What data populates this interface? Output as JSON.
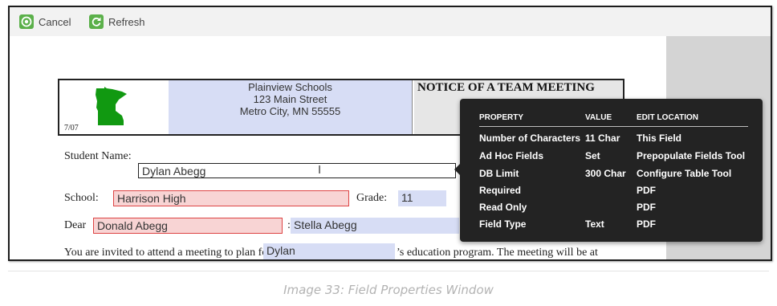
{
  "toolbar": {
    "cancel_label": "Cancel",
    "refresh_label": "Refresh"
  },
  "letterhead": {
    "form_code": "7/07",
    "school_name": "Plainview Schools",
    "address_line1": "123 Main Street",
    "address_line2": "Metro City, MN  55555",
    "title": "NOTICE OF A TEAM MEETING"
  },
  "form": {
    "student_name_label": "Student Name:",
    "student_name_value": "Dylan Abegg",
    "school_label": "School:",
    "school_value": "Harrison High",
    "grade_label": "Grade:",
    "grade_value": "11",
    "dear_label": "Dear",
    "dear_value1": "Donald Abegg",
    "dear_sep": ":",
    "dear_value2": "Stella Abegg",
    "invite_text": "You are invited to attend a meeting to plan for",
    "invite_value": "Dylan",
    "invite_text2": "’s education program. The meeting will be at"
  },
  "popup": {
    "headers": [
      "PROPERTY",
      "VALUE",
      "EDIT LOCATION"
    ],
    "rows": [
      {
        "property": "Number of Characters",
        "value": "11 Char",
        "location": "This Field"
      },
      {
        "property": "Ad Hoc Fields",
        "value": "Set",
        "location": "Prepopulate Fields Tool"
      },
      {
        "property": "DB Limit",
        "value": "300 Char",
        "location": "Configure Table Tool"
      },
      {
        "property": "Required",
        "value": "",
        "location": "PDF"
      },
      {
        "property": "Read Only",
        "value": "",
        "location": "PDF"
      },
      {
        "property": "Field Type",
        "value": "Text",
        "location": "PDF"
      }
    ]
  },
  "caption": "Image 33: Field Properties Window",
  "colors": {
    "toolbar_icon": "#5bb04a",
    "field_blue": "#d7ddf5",
    "field_red_border": "#dd4444",
    "popup_bg": "#232323",
    "map_green": "#119911"
  },
  "icons": [
    "cancel-circle-icon",
    "refresh-icon",
    "minnesota-map-icon",
    "text-cursor-icon"
  ]
}
